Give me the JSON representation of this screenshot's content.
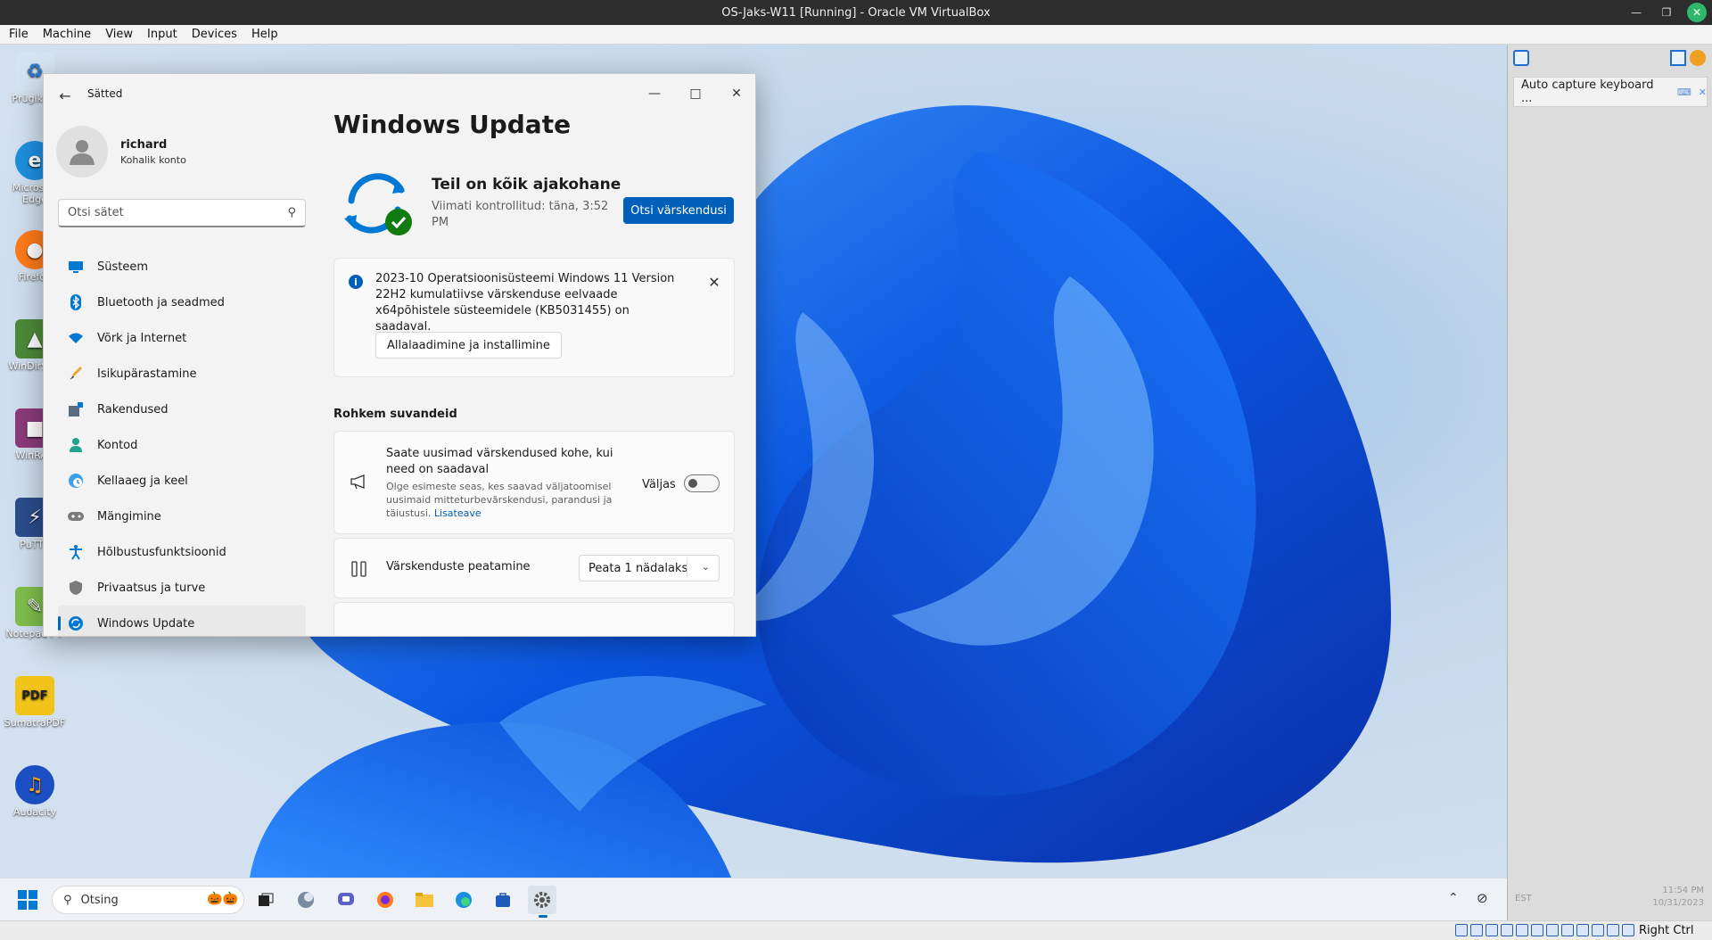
{
  "host": {
    "window_title": "OS-Jaks-W11  [Running]  - Oracle  VM  VirtualBox",
    "menu": [
      "File",
      "Machine",
      "View",
      "Input",
      "Devices",
      "Help"
    ],
    "host_key_label": "Right Ctrl"
  },
  "vb_panel": {
    "capture_label": "Auto capture keyboard ...",
    "keyboard_layout": "EST",
    "clock_time": "11:54 PM",
    "clock_date": "10/31/2023"
  },
  "desktop": {
    "icons": [
      "Prügikast",
      "Microsoft Edge",
      "Firefox",
      "WinDirStat",
      "WinRAR",
      "PuTTY",
      "Notepad++",
      "SumatraPDF",
      "Audacity"
    ]
  },
  "settings": {
    "app_title": "Sätted",
    "user_name": "richard",
    "account_type": "Kohalik konto",
    "search_placeholder": "Otsi sätet",
    "nav": [
      {
        "label": "Süsteem",
        "icon": "monitor-icon",
        "color": "#0078d4"
      },
      {
        "label": "Bluetooth ja seadmed",
        "icon": "bluetooth-icon",
        "color": "#0078d4"
      },
      {
        "label": "Võrk ja Internet",
        "icon": "wifi-icon",
        "color": "#0078d4"
      },
      {
        "label": "Isikupärastamine",
        "icon": "brush-icon",
        "color": "#e8a33a"
      },
      {
        "label": "Rakendused",
        "icon": "apps-icon",
        "color": "#5b6b80"
      },
      {
        "label": "Kontod",
        "icon": "person-icon",
        "color": "#1fa58a"
      },
      {
        "label": "Kellaaeg ja keel",
        "icon": "globe-clock-icon",
        "color": "#0078d4"
      },
      {
        "label": "Mängimine",
        "icon": "gamepad-icon",
        "color": "#6b6b6b"
      },
      {
        "label": "Hõlbustusfunktsioonid",
        "icon": "accessibility-icon",
        "color": "#0078d4"
      },
      {
        "label": "Privaatsus ja turve",
        "icon": "shield-icon",
        "color": "#6b6b6b"
      },
      {
        "label": "Windows Update",
        "icon": "update-icon",
        "color": "#0078d4",
        "active": true
      }
    ],
    "main": {
      "title": "Windows Update",
      "status": "Teil on kõik ajakohane",
      "last_checked": "Viimati kontrollitud: täna, 3:52 PM",
      "check_button": "Otsi värskendusi",
      "notice_text": "2023-10 Operatsioonisüsteemi Windows 11 Version 22H2 kumulatiivse värskenduse eelvaade x64põhistele süsteemidele (KB5031455) on saadaval.",
      "notice_button": "Allalaadimine ja installimine",
      "more_options_heading": "Rohkem suvandeid",
      "early_title": "Saate uusimad värskendused kohe, kui need on saadaval",
      "early_desc": "Olge esimeste seas, kes saavad väljatoomisel uusimaid mitteturbevärskendusi, parandusi ja täiustusi.",
      "early_link": "Lisateave",
      "early_state": "Väljas",
      "early_enabled": false,
      "pause_title": "Värskenduste peatamine",
      "pause_value": "Peata 1 nädalaks"
    }
  },
  "taskbar": {
    "search_placeholder": "Otsing",
    "apps": [
      "task-view-icon",
      "widgets-icon",
      "chat-icon",
      "firefox-icon",
      "file-explorer-icon",
      "edge-icon",
      "store-icon",
      "settings-icon"
    ]
  },
  "colors": {
    "accent": "#005fb8",
    "success": "#107c10"
  }
}
